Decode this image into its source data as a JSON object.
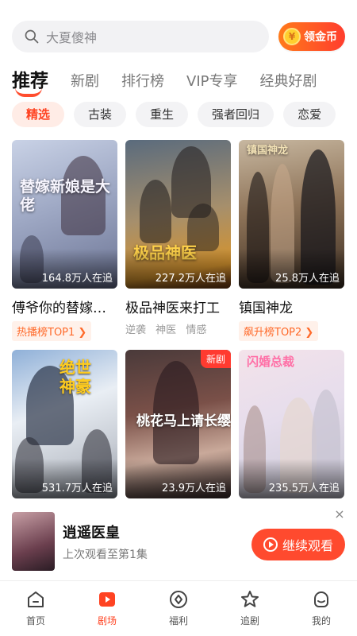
{
  "search": {
    "placeholder": "大夏傻神"
  },
  "coin_button": {
    "label": "领金币",
    "symbol": "¥"
  },
  "tabs": [
    {
      "label": "推荐",
      "active": true
    },
    {
      "label": "新剧"
    },
    {
      "label": "排行榜"
    },
    {
      "label": "VIP专享"
    },
    {
      "label": "经典好剧"
    }
  ],
  "chips": [
    {
      "label": "精选",
      "active": true
    },
    {
      "label": "古装"
    },
    {
      "label": "重生"
    },
    {
      "label": "强者回归"
    },
    {
      "label": "恋爱"
    }
  ],
  "cards": [
    {
      "title": "傅爷你的替嫁…",
      "poster_title": "替嫁新娘是大佬",
      "views": "164.8万人在追",
      "rank_tag": "热播榜TOP1 ❯"
    },
    {
      "title": "极品神医来打工",
      "poster_title": "极品神医",
      "views": "227.2万人在追",
      "tags": [
        "逆袭",
        "神医",
        "情感"
      ]
    },
    {
      "title": "镇国神龙",
      "poster_title": "镇国神龙",
      "views": "25.8万人在追",
      "rank_tag": "飙升榜TOP2 ❯"
    },
    {
      "poster_title": "绝世神豪",
      "views": "531.7万人在追"
    },
    {
      "poster_title": "桃花马上请长缨",
      "views": "23.9万人在追",
      "badge": "新剧"
    },
    {
      "poster_title": "闪婚总裁",
      "views": "235.5万人在追"
    }
  ],
  "continue_watching": {
    "title": "逍遥医皇",
    "subtitle": "上次观看至第1集",
    "button": "继续观看",
    "close": "×"
  },
  "bottom_nav": [
    {
      "label": "首页",
      "icon": "home-icon"
    },
    {
      "label": "剧场",
      "icon": "theater-icon",
      "active": true
    },
    {
      "label": "福利",
      "icon": "gift-icon"
    },
    {
      "label": "追剧",
      "icon": "star-icon"
    },
    {
      "label": "我的",
      "icon": "profile-icon"
    }
  ],
  "colors": {
    "accent": "#ff4322",
    "chip_active_bg": "#ffece6",
    "button_gradient_start": "#ff7a1a",
    "button_gradient_end": "#ff3d2e"
  }
}
